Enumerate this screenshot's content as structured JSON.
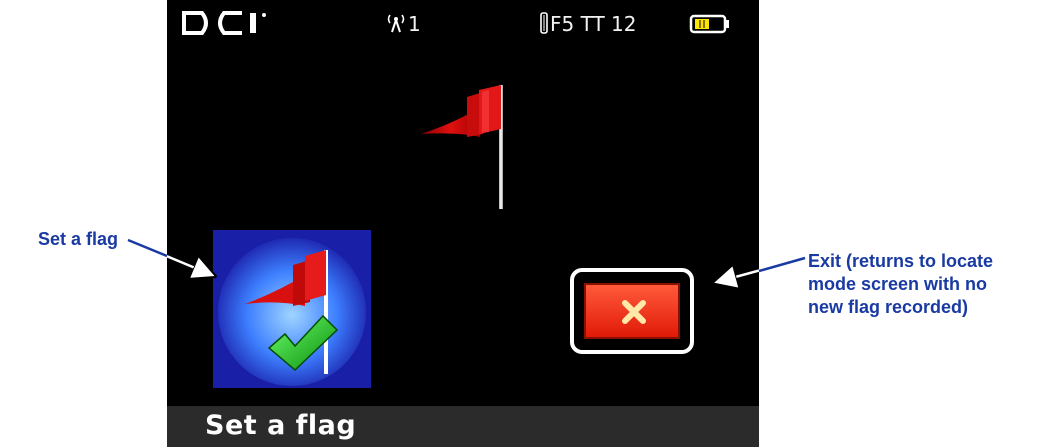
{
  "status_bar": {
    "brand": "DCI",
    "signal_icon": "antenna-icon",
    "channel": "1",
    "freq_icon": "transmitter-icon",
    "freq_label": "F5 TT 12",
    "battery_icon": "battery-icon",
    "battery_color": "#ffe600"
  },
  "main": {
    "flag_icon": "red-flag-icon",
    "set_flag_button_icon": "flag-check-icon",
    "exit_button_icon": "close-x-icon"
  },
  "bottom_bar": {
    "title": "Set a flag"
  },
  "callouts": {
    "left": "Set a flag",
    "right_lines": [
      "Exit (returns to locate",
      "mode screen with no",
      "new flag recorded)"
    ]
  }
}
